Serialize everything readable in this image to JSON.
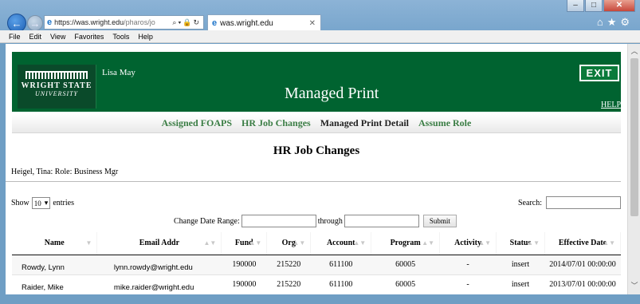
{
  "browser": {
    "address_host": "https://was.wright.edu",
    "address_path": "/pharos/jo",
    "tab_title": "was.wright.edu",
    "menu": [
      "File",
      "Edit",
      "View",
      "Favorites",
      "Tools",
      "Help"
    ]
  },
  "banner": {
    "logo_line1": "WRIGHT STATE",
    "logo_line2": "UNIVERSITY",
    "user": "Lisa May",
    "title": "Managed Print",
    "exit_label": "EXIT",
    "help_label": "HELP"
  },
  "subnav": [
    "Assigned FOAPS",
    "HR Job Changes",
    "Managed Print Detail",
    "Assume Role"
  ],
  "page": {
    "heading": "HR Job Changes",
    "role_text": "Heigel, Tina: Role: Business Mgr"
  },
  "controls": {
    "show_label": "Show",
    "entries_value": "10",
    "entries_label": "entries",
    "search_label": "Search:",
    "date_range_label": "Change Date Range:",
    "through_label": "through",
    "submit_label": "Submit"
  },
  "table": {
    "columns": [
      "Name",
      "Email Addr",
      "Fund",
      "Org",
      "Account",
      "Program",
      "Activity",
      "Status",
      "Effective Date"
    ],
    "rows": [
      [
        "Rowdy, Lynn",
        "lynn.rowdy@wright.edu",
        "190000",
        "215220",
        "611100",
        "60005",
        "-",
        "insert",
        "2014/07/01 00:00:00"
      ],
      [
        "Raider, Mike",
        "mike.raider@wright.edu",
        "190000",
        "215220",
        "611100",
        "60005",
        "-",
        "insert",
        "2013/07/01 00:00:00"
      ]
    ]
  }
}
